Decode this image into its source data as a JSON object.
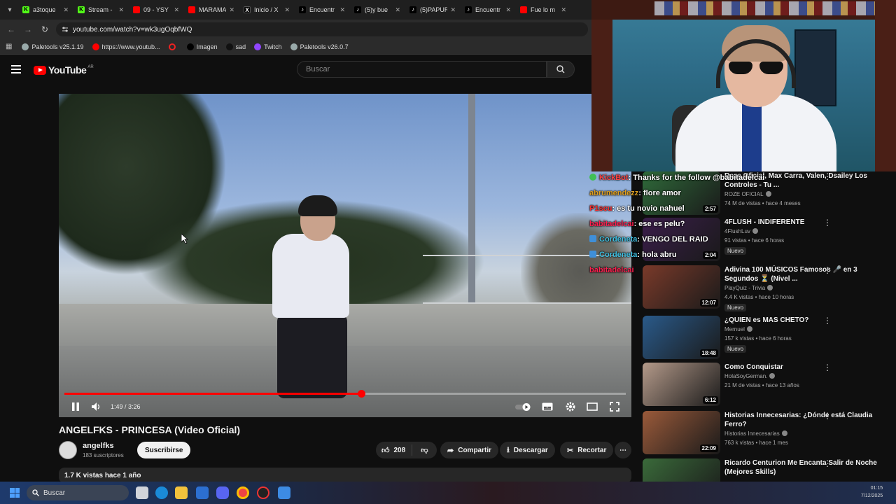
{
  "browser": {
    "tabs": [
      {
        "label": "a3toque",
        "icon": "kick"
      },
      {
        "label": "Stream -",
        "icon": "kick"
      },
      {
        "label": "09 - YSY",
        "icon": "yt"
      },
      {
        "label": "MARAMA",
        "icon": "yt"
      },
      {
        "label": "Inicio / X",
        "icon": "x"
      },
      {
        "label": "Encuentr",
        "icon": "tiktok"
      },
      {
        "label": "(5)y bue",
        "icon": "tiktok"
      },
      {
        "label": "(5)PAPUR",
        "icon": "tiktok"
      },
      {
        "label": "Encuentr",
        "icon": "tiktok"
      },
      {
        "label": "Fue lo m",
        "icon": "yt"
      }
    ],
    "url": "youtube.com/watch?v=wk3ugOqbfWQ",
    "bookmarks": [
      {
        "label": "Paletools v25.1.19",
        "icon": "paletools-icon"
      },
      {
        "label": "https://www.youtub...",
        "icon": "youtube-icon"
      },
      {
        "label": "",
        "icon": "red-ring-icon"
      },
      {
        "label": "Imagen",
        "icon": "x-icon"
      },
      {
        "label": "sad",
        "icon": "tiktok-icon"
      },
      {
        "label": "Twitch",
        "icon": "twitch-icon"
      },
      {
        "label": "Paletools v26.0.7",
        "icon": "paletools-icon"
      }
    ]
  },
  "youtube": {
    "logo_text": "YouTube",
    "country": "AR",
    "search_placeholder": "Buscar",
    "player": {
      "time": "1:49 / 3:26",
      "progress": 0.529
    },
    "video_title": "ANGELFKS - PRINCESA (Video Oficial)",
    "channel": {
      "name": "angelfks",
      "subs": "183 suscriptores",
      "subscribe_label": "Suscribirse"
    },
    "actions": {
      "likes": "208",
      "share": "Compartir",
      "download": "Descargar",
      "clip": "Recortar"
    },
    "description": "1.7 K vistas  hace 1 año"
  },
  "chat": [
    {
      "user": "KickBot",
      "user_color": "#ff4545",
      "message": ": Thanks for the follow @babitadelcai",
      "badge": "mod"
    },
    {
      "user": "abrumendezz",
      "user_color": "#e0a020",
      "message": ": flore amor",
      "badge": ""
    },
    {
      "user": "P1scu",
      "user_color": "#ff3030",
      "message": ": es tu novio nahuel",
      "badge": ""
    },
    {
      "user": "babitadelcai",
      "user_color": "#ff2050",
      "message": ": ese es pelu?",
      "badge": ""
    },
    {
      "user": "Cordeneta",
      "user_color": "#3fbfe0",
      "message": ": VENGO DEL RAID",
      "badge": "sub"
    },
    {
      "user": "Cordeneta",
      "user_color": "#3fbfe0",
      "message": ": hola abru",
      "badge": "sub"
    },
    {
      "user": "babitadelcai",
      "user_color": "#ff2050",
      "message": "",
      "badge": ""
    }
  ],
  "recommendations": [
    {
      "title": "Roze Oficial, Max Carra, Valen, Dsailey Los Controles - Tu ...",
      "channel": "ROZE OFICIAL",
      "meta": "74 M de vistas • hace 4 meses",
      "duration": "2:57",
      "new": "",
      "thumb": "#2f6a3a"
    },
    {
      "title": "4FLUSH - INDIFERENTE",
      "channel": "4FlushLuv",
      "meta": "91 vistas • hace 6 horas",
      "duration": "2:04",
      "new": "Nuevo",
      "thumb": "#3a1d4a"
    },
    {
      "title": "Adivina 100 MÚSICOS Famosos 🎤 en 3 Segundos ⏳ (Nivel ...",
      "channel": "PlayQuiz - Trivia",
      "meta": "4.4 K vistas • hace 10 horas",
      "duration": "12:07",
      "new": "Nuevo",
      "thumb": "#7a3a2a"
    },
    {
      "title": "¿QUIEN es MAS CHETO?",
      "channel": "Mernuel",
      "meta": "157 k vistas • hace 6 horas",
      "duration": "18:48",
      "new": "Nuevo",
      "thumb": "#2a5a8a"
    },
    {
      "title": "Como Conquistar",
      "channel": "HolaSoyGerman.",
      "meta": "21 M de vistas • hace 13 años",
      "duration": "6:12",
      "new": "",
      "thumb": "#b49a8a"
    },
    {
      "title": "Historias Innecesarias: ¿Dónde está Claudia Ferro?",
      "channel": "Historias Innecesarias",
      "meta": "763 k vistas • hace 1 mes",
      "duration": "22:09",
      "new": "",
      "thumb": "#9a5a3a"
    },
    {
      "title": "Ricardo Centurion Me Encanta Salir de Noche (Mejores Skills)",
      "channel": "",
      "meta": "",
      "duration": "",
      "new": "",
      "thumb": "#3a6a3a"
    }
  ],
  "taskbar": {
    "search_placeholder": "Buscar",
    "clock_time": "01:15",
    "clock_date": "7/12/2025"
  },
  "colors": {
    "accent_red": "#ff0000",
    "background": "#0f0f0f"
  }
}
